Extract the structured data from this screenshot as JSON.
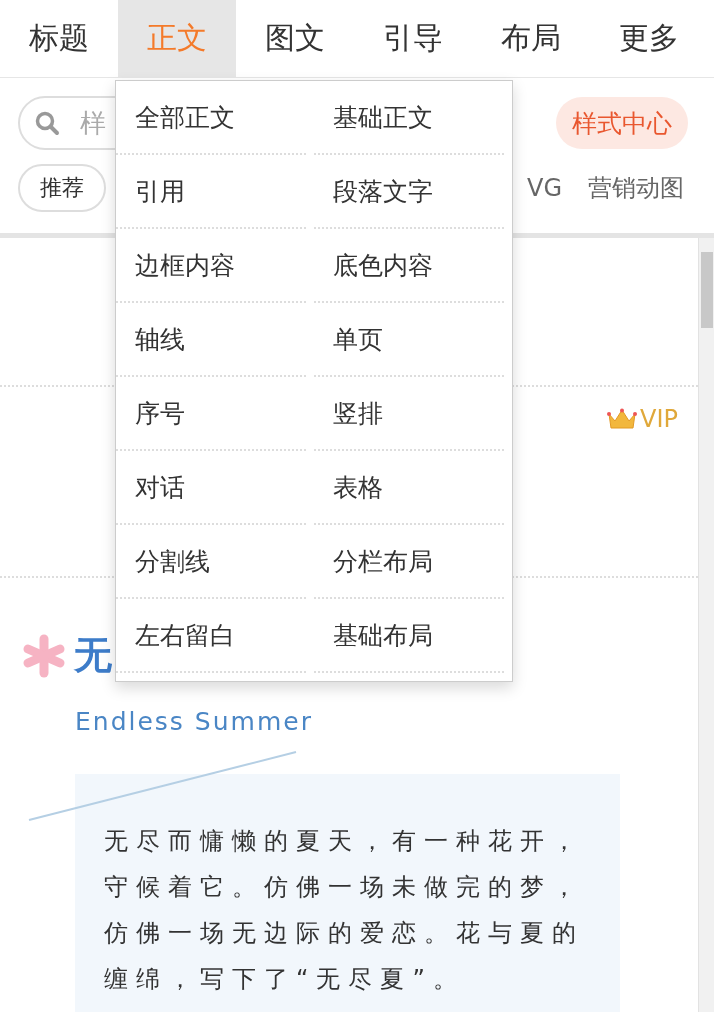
{
  "tabs": [
    {
      "label": "标题",
      "selected": false
    },
    {
      "label": "正文",
      "selected": true
    },
    {
      "label": "图文",
      "selected": false
    },
    {
      "label": "引导",
      "selected": false
    },
    {
      "label": "布局",
      "selected": false
    },
    {
      "label": "更多",
      "selected": false
    }
  ],
  "search": {
    "placeholder": "样"
  },
  "style_center_button": "样式中心",
  "categories": [
    {
      "label": "推荐",
      "kind": "chip"
    },
    {
      "label": "VG",
      "kind": "plain"
    },
    {
      "label": "营销动图",
      "kind": "plain"
    }
  ],
  "style_rows": [
    {
      "kind": "empty"
    },
    {
      "kind": "vip",
      "badge": "VIP"
    },
    {
      "kind": "preview",
      "title": "无",
      "subtitle": "Endless Summer",
      "body": "无尽而慵懒的夏天，有一种花开，守候着它。仿佛一场未做完的梦，仿佛一场无边际的爱恋。花与夏的缠绵，写下了“无尽夏”。"
    }
  ],
  "dropdown": {
    "items": [
      "全部正文",
      "基础正文",
      "引用",
      "段落文字",
      "边框内容",
      "底色内容",
      "轴线",
      "单页",
      "序号",
      "竖排",
      "对话",
      "表格",
      "分割线",
      "分栏布局",
      "左右留白",
      "基础布局"
    ]
  }
}
